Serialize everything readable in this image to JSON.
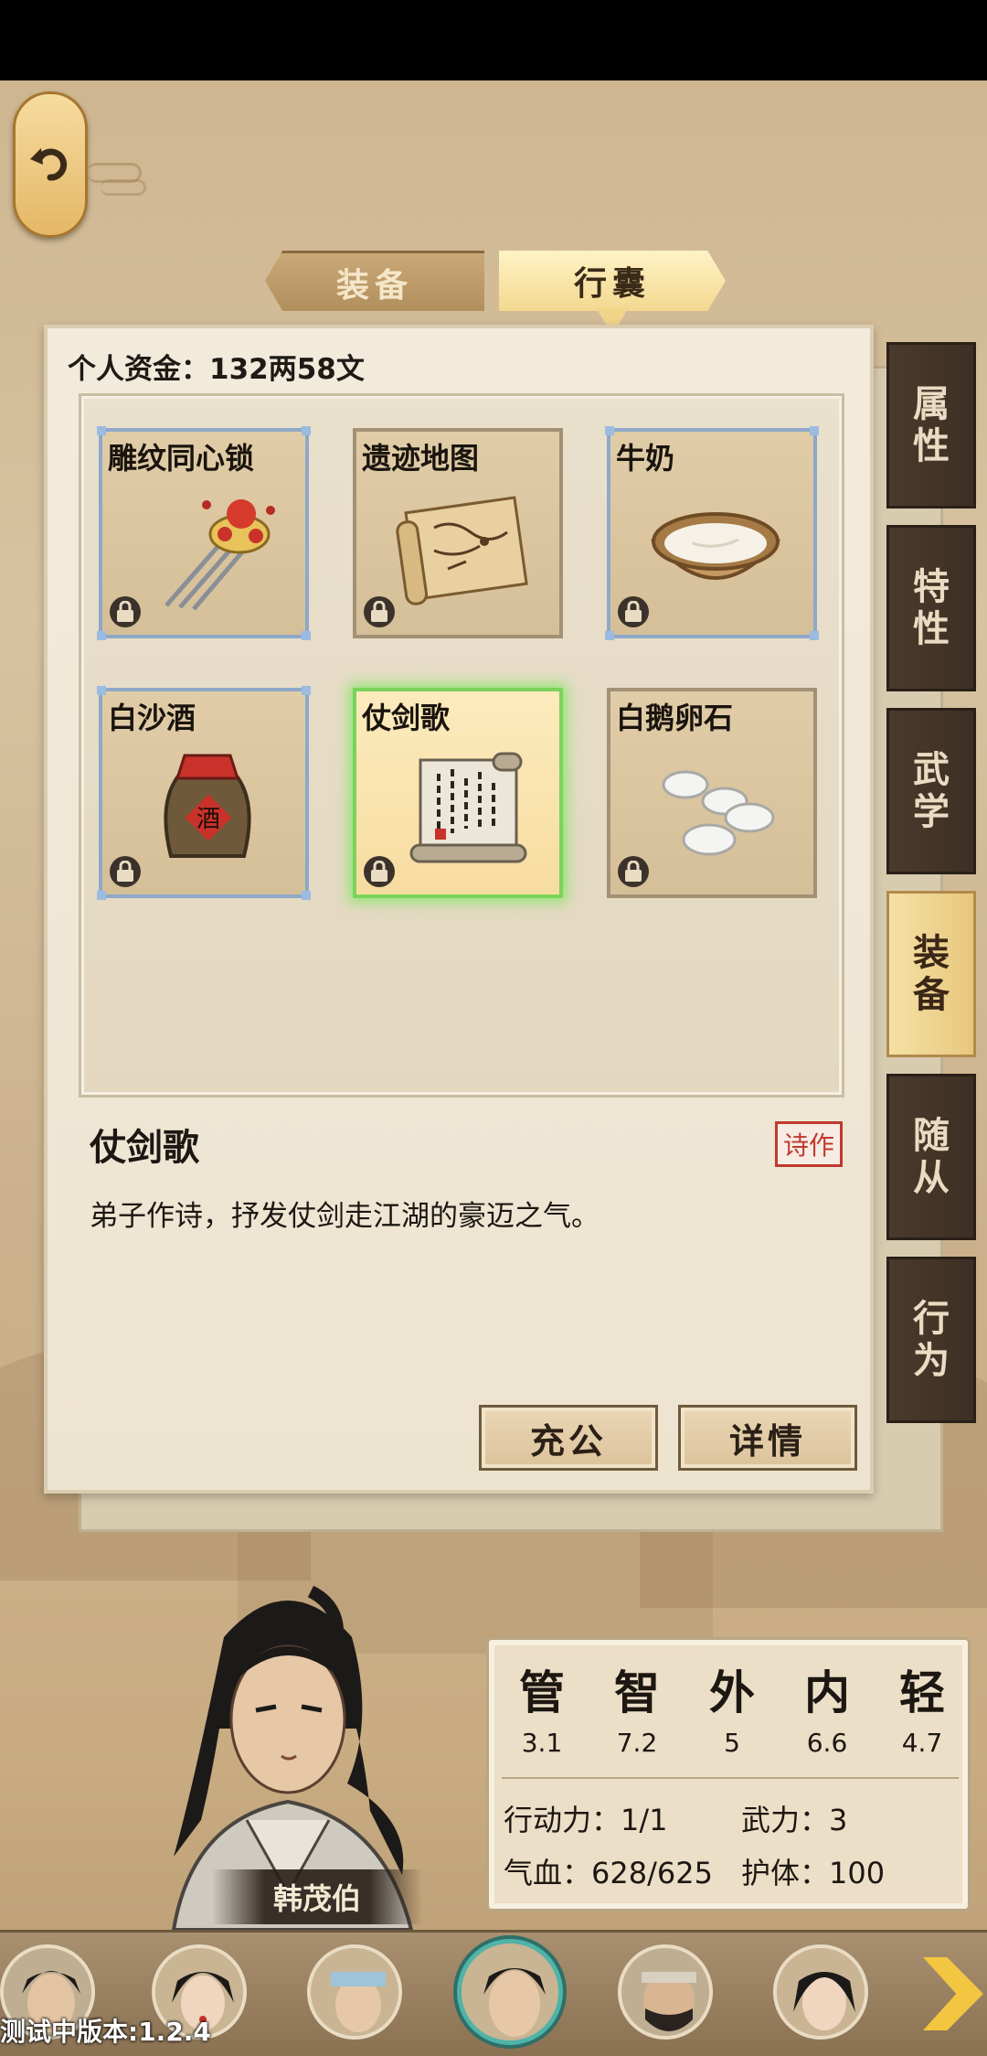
{
  "tabs": {
    "equipment": "装备",
    "bag": "行囊"
  },
  "money": "个人资金：132两58文",
  "items": [
    {
      "name": "雕纹同心锁",
      "icon": "hairpin-icon"
    },
    {
      "name": "遗迹地图",
      "icon": "map-scroll-icon"
    },
    {
      "name": "牛奶",
      "icon": "milk-bowl-icon"
    },
    {
      "name": "白沙酒",
      "icon": "wine-jar-icon",
      "art_label": "酒"
    },
    {
      "name": "仗剑歌",
      "icon": "poem-scroll-icon",
      "selected": true
    },
    {
      "name": "白鹅卵石",
      "icon": "pebbles-icon"
    }
  ],
  "detail": {
    "name": "仗剑歌",
    "tag": "诗作",
    "description": "弟子作诗，抒发仗剑走江湖的豪迈之气。"
  },
  "actions": {
    "donate": "充公",
    "details": "详情"
  },
  "side_tabs": [
    {
      "label": "属性"
    },
    {
      "label": "特性"
    },
    {
      "label": "武学"
    },
    {
      "label": "装备",
      "active": true
    },
    {
      "label": "随从"
    },
    {
      "label": "行为"
    }
  ],
  "stats": {
    "columns": [
      {
        "label": "管",
        "value": "3.1"
      },
      {
        "label": "智",
        "value": "7.2"
      },
      {
        "label": "外",
        "value": "5"
      },
      {
        "label": "内",
        "value": "6.6"
      },
      {
        "label": "轻",
        "value": "4.7"
      }
    ],
    "action_power": "行动力：1/1",
    "martial_power": "武力：3",
    "hp": "气血：628/625",
    "defense": "护体：100"
  },
  "character": {
    "name": "韩茂伯"
  },
  "version": "测试中版本:1.2.4",
  "colors": {
    "selected_glow": "#7ad45a",
    "tag_red": "#c03a2e",
    "roster_ring": "#4fb3a8",
    "next_arrow": "#f2c640"
  }
}
